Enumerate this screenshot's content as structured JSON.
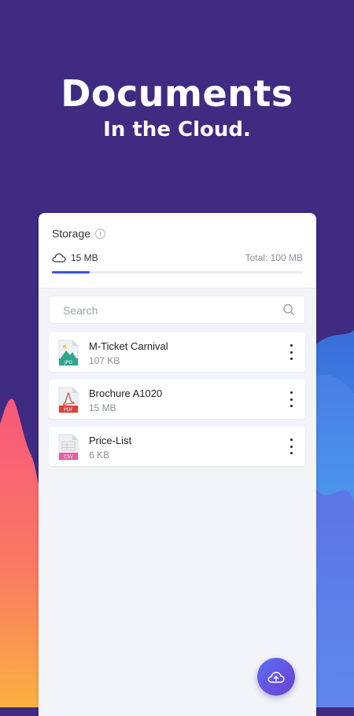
{
  "hero": {
    "title": "Documents",
    "subtitle": "In the Cloud."
  },
  "storage": {
    "title": "Storage",
    "used": "15 MB",
    "total": "Total: 100 MB",
    "used_fraction": 0.15,
    "accent_color": "#3a55d8"
  },
  "search": {
    "placeholder": "Search"
  },
  "files": [
    {
      "name": "M-Ticket Carnival",
      "size": "107 KB",
      "type": "JPG",
      "icon": "jpg-file-icon",
      "color": "#2fa58d"
    },
    {
      "name": "Brochure A1020",
      "size": "15 MB",
      "type": "PDF",
      "icon": "pdf-file-icon",
      "color": "#d9443a"
    },
    {
      "name": "Price-List",
      "size": "6 KB",
      "type": "CSV",
      "icon": "csv-file-icon",
      "color": "#e0609e"
    }
  ],
  "colors": {
    "background": "#3f2b82",
    "fab": "#5b5fe8"
  }
}
